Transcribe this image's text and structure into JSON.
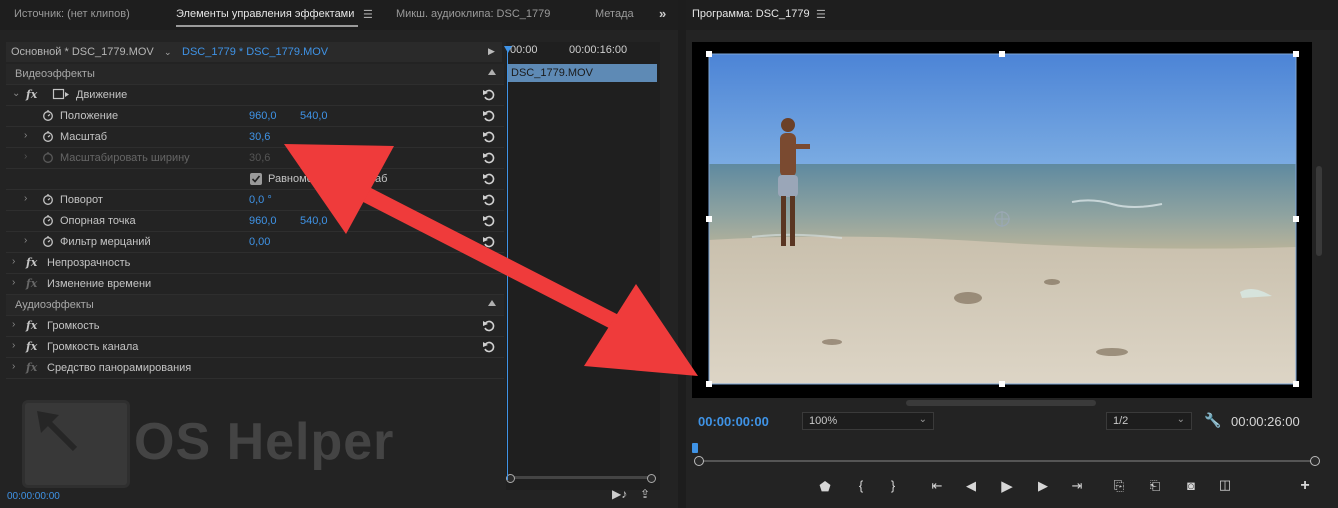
{
  "left_panel": {
    "tabs": [
      "Источник: (нет клипов)",
      "Элементы управления эффектами",
      "Микш. аудиоклипа: DSC_1779",
      "Метада"
    ],
    "master_clip": "Основной * DSC_1779.MOV",
    "sequence_clip": "DSC_1779 * DSC_1779.MOV",
    "timecodes": {
      "start": "00:00",
      "end": "00:00:16:00"
    },
    "clip_name": "DSC_1779.MOV",
    "video_section": "Видеоэффекты",
    "audio_section": "Аудиоэффекты",
    "motion": "Движение",
    "properties": {
      "position": {
        "label": "Положение",
        "x": "960,0",
        "y": "540,0"
      },
      "scale": {
        "label": "Масштаб",
        "value": "30,6"
      },
      "scale_width": {
        "label": "Масштабировать ширину",
        "value": "30,6"
      },
      "uniform": {
        "label": "Равномерный масштаб"
      },
      "rotation": {
        "label": "Поворот",
        "value": "0,0 °"
      },
      "anchor": {
        "label": "Опорная точка",
        "x": "960,0",
        "y": "540,0"
      },
      "flicker": {
        "label": "Фильтр мерцаний",
        "value": "0,00"
      }
    },
    "opacity": "Непрозрачность",
    "time_remap": "Изменение времени",
    "volume": "Громкость",
    "channel_volume": "Громкость канала",
    "panner": "Средство панорамирования",
    "bottom_timecode": "00:00:00:00",
    "watermark": "OS Helper"
  },
  "right_panel": {
    "title": "Программа: DSC_1779",
    "current_time": "00:00:00:00",
    "zoom": "100%",
    "resolution": "1/2",
    "duration": "00:00:26:00"
  },
  "colors": {
    "accent": "#3f93e6",
    "arrow": "#ef3b3b",
    "clip": "#5e8ab5"
  }
}
